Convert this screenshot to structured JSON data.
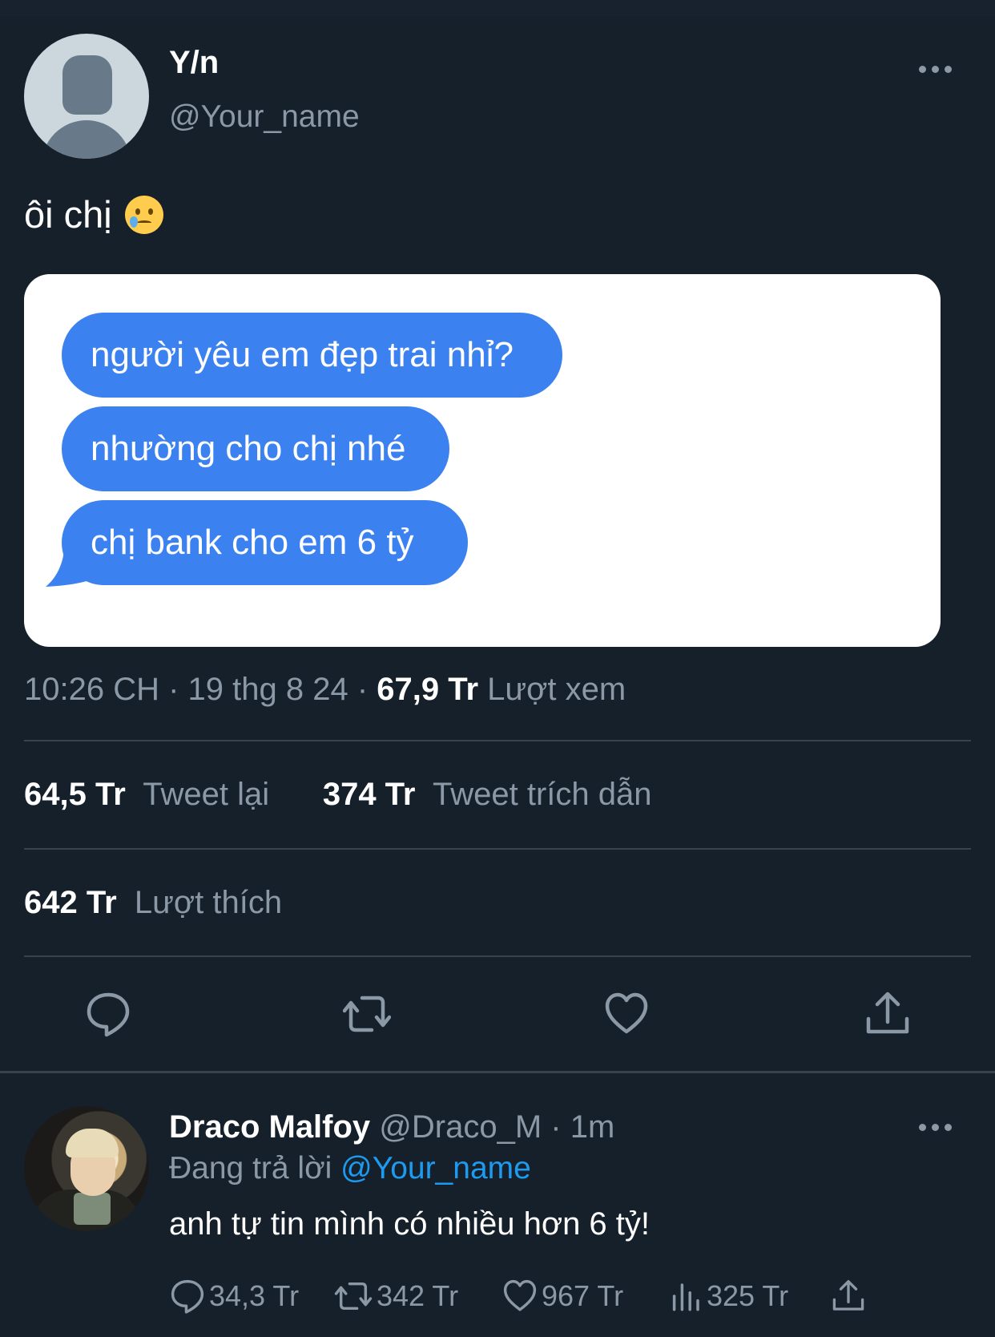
{
  "tweet": {
    "display_name": "Y/n",
    "handle": "@Your_name",
    "text": "ôi chị",
    "emoji": "face-holding-back-tears",
    "image_messages": [
      "người yêu em đẹp trai nhỉ?",
      "nhường cho chị nhé",
      "chị bank cho em 6 tỷ"
    ],
    "time": "10:26 CH · 19 thg 8 24 ·",
    "views_count": "67,9 Tr",
    "views_label": "Lượt xem",
    "retweets_count": "64,5 Tr",
    "retweets_label": "Tweet lại",
    "quotes_count": "374 Tr",
    "quotes_label": "Tweet trích dẫn",
    "likes_count": "642 Tr",
    "likes_label": "Lượt thích"
  },
  "reply": {
    "display_name": "Draco Malfoy",
    "handle_time": "@Draco_M · 1m",
    "replying_prefix": "Đang trả lời",
    "replying_to": "@Your_name",
    "text": "anh tự tin mình có nhiều hơn 6 tỷ!",
    "reply_count": "34,3 Tr",
    "retweet_count": "342 Tr",
    "like_count": "967 Tr",
    "view_count": "325 Tr"
  },
  "colors": {
    "background": "#15202b",
    "bubble": "#3b82f0",
    "muted": "#8b98a5",
    "link": "#1d9bf0"
  }
}
